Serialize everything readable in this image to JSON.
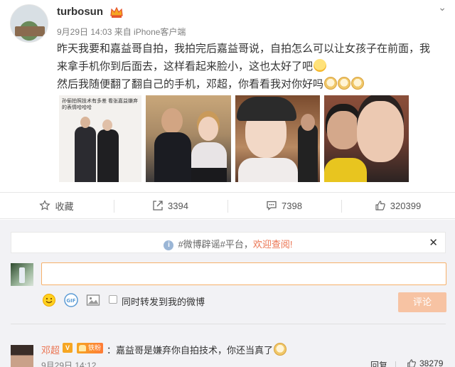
{
  "post": {
    "username": "turbosun",
    "meta": "9月29日 14:03 来自 iPhone客户端",
    "text_line1": "昨天我要和嘉益哥自拍，我拍完后嘉益哥说，自拍怎么可以让女孩子在前面，我",
    "text_line2": "来拿手机你到后面去，这样看起来脸小，这也太好了吧",
    "text_line3": "然后我随便翻了翻自己的手机，邓超，你看看我对你好吗",
    "photo1_caption": "孙俪拍照技术有多差 看张嘉益嫌弃的表情哈哈哈"
  },
  "actions": {
    "favorite": "收藏",
    "repost": "3394",
    "comment": "7398",
    "like": "320399"
  },
  "notice": {
    "text": "#微博辟谣#平台，",
    "link": "欢迎查阅!"
  },
  "composer": {
    "input_value": "",
    "checkbox_label": "同时转发到我的微博",
    "submit_label": "评论"
  },
  "reply": {
    "name": "邓超",
    "fan_badge": "铁粉",
    "text": "：嘉益哥是嫌弃你自拍技术，你还当真了",
    "time": "9月29日 14:12",
    "reply_label": "回复",
    "likes": "38279"
  },
  "colors": {
    "accent_orange": "#eb7350",
    "submit_disabled": "#f7c3a3",
    "input_border": "#f6b06a"
  }
}
